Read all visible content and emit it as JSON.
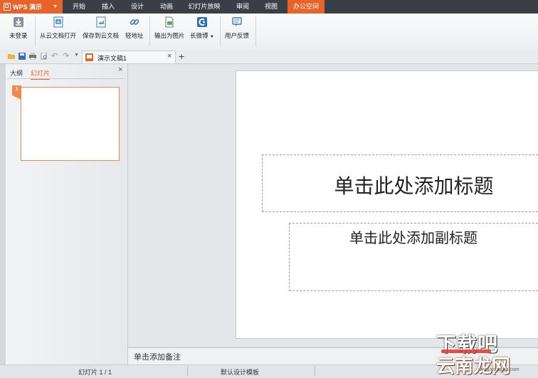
{
  "app": {
    "name": "WPS 演示",
    "accent": "#e8632a"
  },
  "menu": {
    "tabs": [
      {
        "label": "开始"
      },
      {
        "label": "插入"
      },
      {
        "label": "设计"
      },
      {
        "label": "动画"
      },
      {
        "label": "幻灯片放映"
      },
      {
        "label": "审阅"
      },
      {
        "label": "视图"
      },
      {
        "label": "办公空间"
      }
    ],
    "active": "办公空间"
  },
  "ribbon": {
    "buttons": [
      {
        "label": "未登录",
        "icon": "download-icon"
      },
      {
        "label": "从云文档打开",
        "icon": "cloud-open-icon"
      },
      {
        "label": "保存到云文档",
        "icon": "cloud-save-icon"
      },
      {
        "label": "轻地址",
        "icon": "link-icon"
      },
      {
        "label": "输出为图片",
        "icon": "export-image-icon"
      },
      {
        "label": "长微博",
        "icon": "weibo-icon"
      },
      {
        "label": "用户反馈",
        "icon": "feedback-icon"
      }
    ]
  },
  "document": {
    "tab_title": "演示文稿1",
    "close": "×",
    "new_tab": "+"
  },
  "left_panel": {
    "tabs": [
      "大纲",
      "幻灯片"
    ],
    "active_tab": "幻灯片",
    "close": "×",
    "slides": [
      {
        "number": "1"
      }
    ]
  },
  "slide": {
    "title_placeholder": "单击此处添加标题",
    "subtitle_placeholder": "单击此处添加副标题"
  },
  "notes": {
    "placeholder": "单击添加备注"
  },
  "status": {
    "slide_info": "幻灯片 1 / 1",
    "template": "默认设计模板"
  },
  "watermark": {
    "top": "下载吧",
    "brand": "云南龙网",
    "url": "www.xiazaiba.com"
  }
}
